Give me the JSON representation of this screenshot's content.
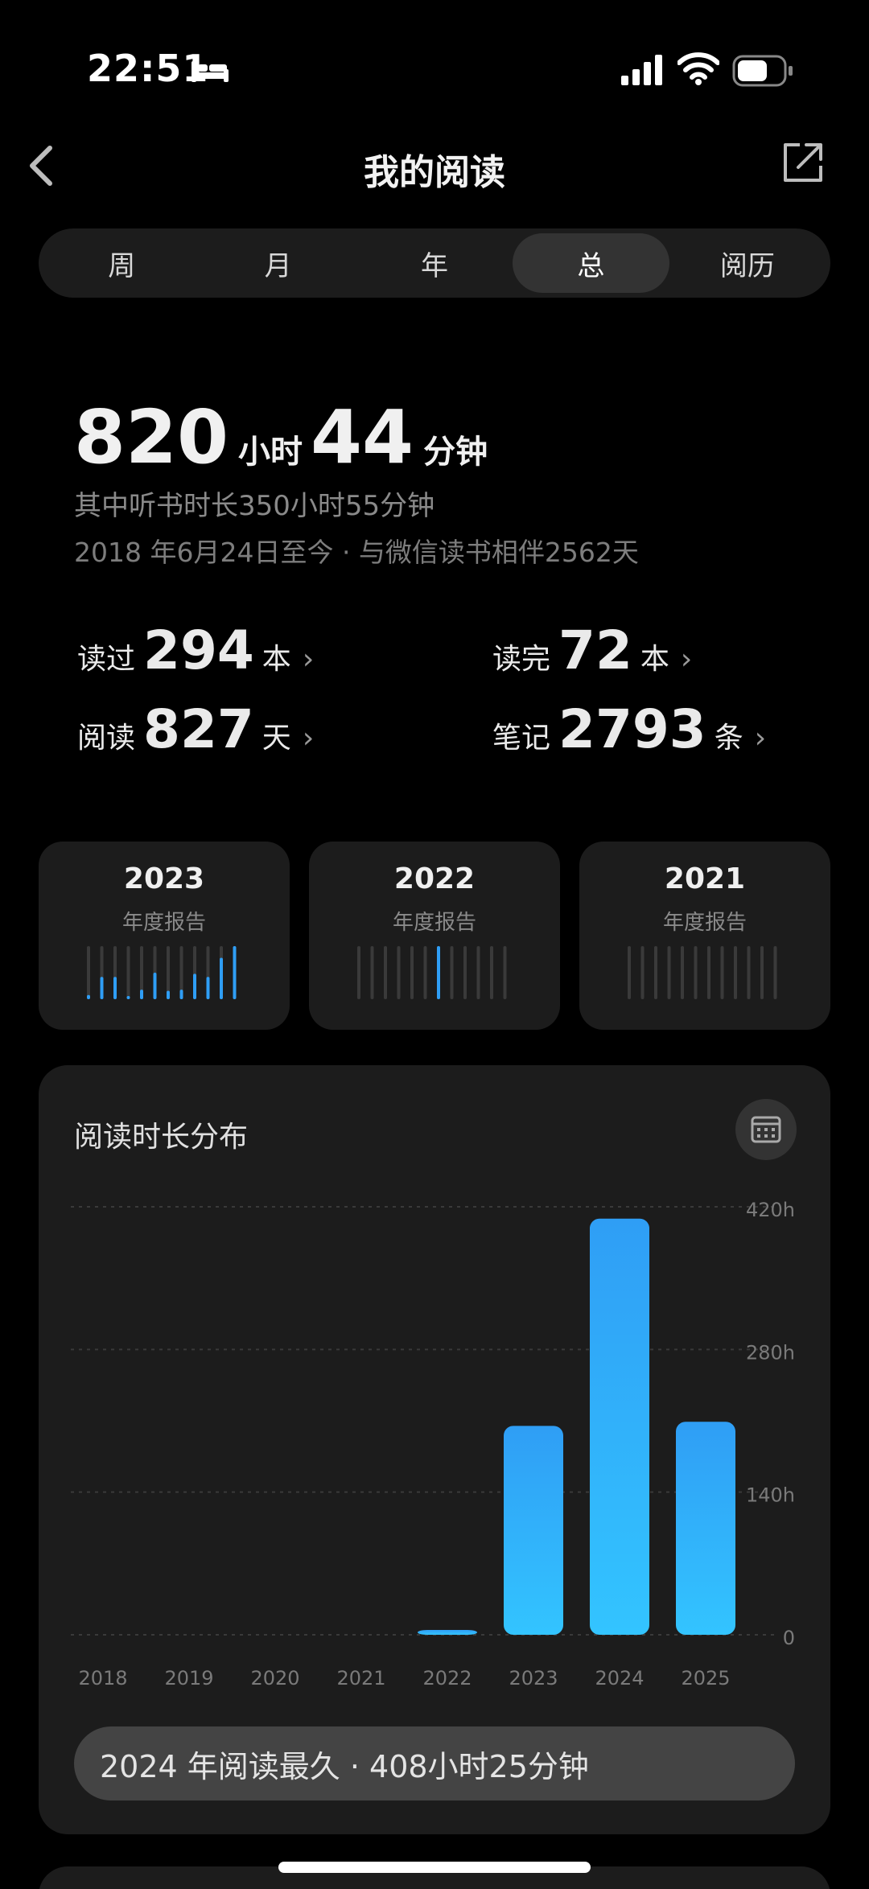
{
  "status": {
    "time": "22:51"
  },
  "nav": {
    "title": "我的阅读"
  },
  "tabs": [
    {
      "label": "周"
    },
    {
      "label": "月"
    },
    {
      "label": "年"
    },
    {
      "label": "总",
      "active": true
    },
    {
      "label": "阅历"
    }
  ],
  "summary": {
    "hours": "820",
    "hours_unit": "小时",
    "minutes": "44",
    "minutes_unit": "分钟",
    "listen_line": "其中听书时长350小时55分钟",
    "since_line": "2018 年6月24日至今 · 与微信读书相伴2562天"
  },
  "stats": {
    "read": {
      "label": "读过",
      "value": "294",
      "unit": "本"
    },
    "finished": {
      "label": "读完",
      "value": "72",
      "unit": "本"
    },
    "days": {
      "label": "阅读",
      "value": "827",
      "unit": "天"
    },
    "notes": {
      "label": "笔记",
      "value": "2793",
      "unit": "条"
    }
  },
  "year_reports": [
    {
      "year": "2023",
      "label": "年度报告",
      "bars": [
        0.08,
        0.42,
        0.42,
        0.06,
        0.18,
        0.5,
        0.16,
        0.18,
        0.48,
        0.42,
        0.78,
        1.0
      ]
    },
    {
      "year": "2022",
      "label": "年度报告",
      "bars": [
        0,
        0,
        0,
        0,
        0,
        0,
        1.0,
        0,
        0,
        0,
        0,
        0
      ]
    },
    {
      "year": "2021",
      "label": "年度报告",
      "bars": [
        0,
        0,
        0,
        0,
        0,
        0,
        0,
        0,
        0,
        0,
        0,
        0
      ]
    }
  ],
  "chart_data": {
    "type": "bar",
    "title": "阅读时长分布",
    "categories": [
      "2018",
      "2019",
      "2020",
      "2021",
      "2022",
      "2023",
      "2024",
      "2025"
    ],
    "values": [
      0,
      0,
      0,
      0,
      3,
      205,
      408.4,
      209
    ],
    "yticks": [
      "420h",
      "280h",
      "140h",
      "0"
    ],
    "ylim": [
      0,
      420
    ],
    "grid": true,
    "colors": {
      "bar_top": "#2f9ef5",
      "bar_bottom": "#33c4ff",
      "grid": "#3a3a3a"
    }
  },
  "highlight": {
    "text": "2024 年阅读最久 · 408小时25分钟"
  }
}
